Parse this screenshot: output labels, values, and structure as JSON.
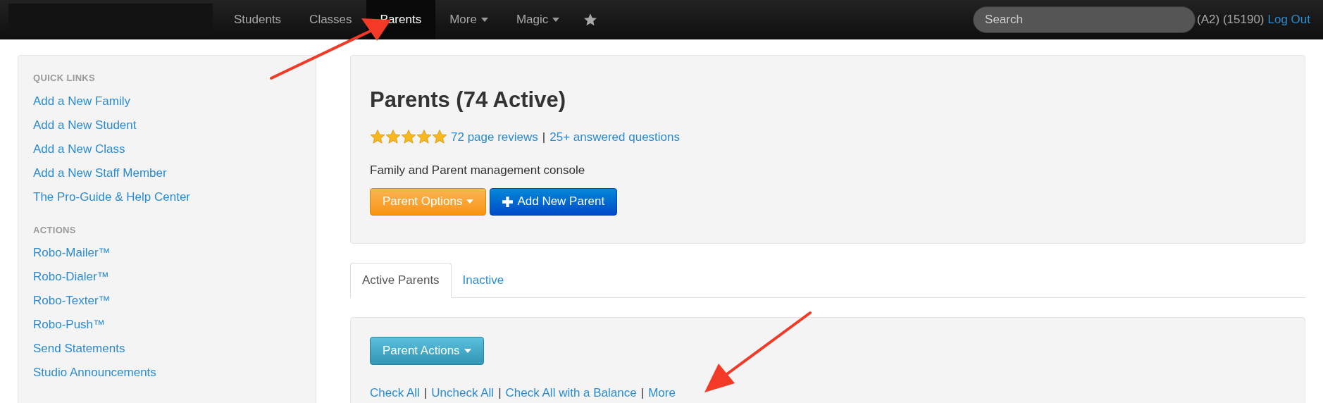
{
  "navbar": {
    "items": [
      {
        "label": "Students",
        "selected": false,
        "has_menu": false
      },
      {
        "label": "Classes",
        "selected": false,
        "has_menu": false
      },
      {
        "label": "Parents",
        "selected": true,
        "has_menu": false
      },
      {
        "label": "More",
        "selected": false,
        "has_menu": true
      },
      {
        "label": "Magic",
        "selected": false,
        "has_menu": true
      }
    ],
    "search": {
      "placeholder": "Search"
    },
    "account": "(A2) (15190)",
    "logout": "Log Out"
  },
  "sidebar": {
    "sections": [
      {
        "heading": "QUICK LINKS",
        "links": [
          "Add a New Family",
          "Add a New Student",
          "Add a New Class",
          "Add a New Staff Member",
          "The Pro-Guide & Help Center"
        ]
      },
      {
        "heading": "ACTIONS",
        "links": [
          "Robo-Mailer™",
          "Robo-Dialer™",
          "Robo-Texter™",
          "Robo-Push™",
          "Send Statements",
          "Studio Announcements"
        ]
      }
    ]
  },
  "header": {
    "title": "Parents (74 Active)",
    "stars": 5,
    "meta": [
      {
        "kind": "link",
        "text": "72 page reviews"
      },
      {
        "kind": "sep",
        "text": "|"
      },
      {
        "kind": "link",
        "text": "25+ answered questions"
      }
    ],
    "description": "Family and Parent management console",
    "buttons": [
      {
        "kind": "dropdown",
        "label": "Parent Options"
      },
      {
        "kind": "add",
        "label": "Add New Parent"
      }
    ]
  },
  "tabs": [
    {
      "label": "Active Parents",
      "selected": true
    },
    {
      "label": "Inactive",
      "selected": false
    }
  ],
  "actions": {
    "button": "Parent Actions",
    "links": [
      {
        "kind": "link",
        "text": "Check All"
      },
      {
        "kind": "sep",
        "text": "|"
      },
      {
        "kind": "link",
        "text": "Uncheck All"
      },
      {
        "kind": "sep",
        "text": "|"
      },
      {
        "kind": "link",
        "text": "Check All with a Balance"
      },
      {
        "kind": "sep",
        "text": "|"
      },
      {
        "kind": "link",
        "text": "More"
      }
    ]
  }
}
